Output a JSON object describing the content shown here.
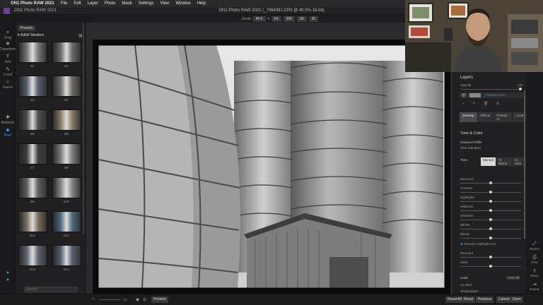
{
  "menubar": {
    "app_name": "ON1 Photo RAW 2021",
    "menus": [
      "File",
      "Edit",
      "Layer",
      "Photo",
      "Mask",
      "Settings",
      "View",
      "Window",
      "Help"
    ]
  },
  "window": {
    "title": "ON1 Photo RAW 2021 (_7064261.CR3 @ 40.5% 16-bit)",
    "app_label": "ON1 Photo RAW 2021"
  },
  "toolbar": {
    "zoom_label": "Zoom",
    "zoom_value": "40.5",
    "fit_label": "Fit",
    "zoom_presets": [
      "100",
      "50",
      "25"
    ]
  },
  "tools": [
    {
      "label": "Crop",
      "icon": "crop-icon",
      "glyph": "⌗"
    },
    {
      "label": "Transform",
      "icon": "transform-icon",
      "glyph": "✥"
    },
    {
      "label": "Text",
      "icon": "text-icon",
      "glyph": "T"
    },
    {
      "label": "Local",
      "icon": "brush-icon",
      "glyph": "✎"
    },
    {
      "label": "Faces",
      "icon": "face-icon",
      "glyph": "☺"
    },
    {
      "label": "Retouch",
      "icon": "retouch-icon",
      "glyph": "✚"
    },
    {
      "label": "Pixel",
      "icon": "pixel-icon",
      "glyph": "◆"
    }
  ],
  "presets": {
    "tab_label": "Presets",
    "category": "B&W Modern",
    "search_placeholder": "Search",
    "items": [
      "B1",
      "B2",
      "B3",
      "B4",
      "B5",
      "B6",
      "B7",
      "B8",
      "B9",
      "B10",
      "B11",
      "B12",
      "B13",
      "B14"
    ],
    "tints": [
      "#777",
      "#6a6a6a",
      "#55606e",
      "#6e6a63",
      "#4d4a4d",
      "#8a7c66",
      "#3d3d3d",
      "#7d7d7d",
      "#5f5f5f",
      "#858585",
      "#7a6c5c",
      "#4e6a80",
      "#5d6470",
      "#54606e"
    ]
  },
  "right_panel": {
    "layers_title": "Layers",
    "opacity_label": "Opacity",
    "opacity_value": 100,
    "layer_name": "_7064261.CR3",
    "module_tabs": [
      "Develop",
      "Effects",
      "Portrait AI",
      "Local"
    ],
    "selected_tab": "Develop",
    "section_title": "Tone & Color",
    "camera_profile_label": "Camera Profile",
    "camera_profile_value": "ON1 Standard",
    "tone_label": "Tone:",
    "tone_modes": [
      "Manual",
      "AI Match",
      "AI Auto"
    ],
    "selected_tone_mode": "Manual",
    "sliders": [
      {
        "label": "Exposure",
        "value": 0.5
      },
      {
        "label": "Contrast",
        "value": 0.5
      },
      {
        "label": "Highlights",
        "value": 0.5
      },
      {
        "label": "Midtones",
        "value": 0.5
      },
      {
        "label": "Shadows",
        "value": 0.5
      },
      {
        "label": "Whites",
        "value": 0.5
      },
      {
        "label": "Blacks",
        "value": 0.5
      }
    ],
    "recover_label": "Recover Highlight Hue",
    "structure_label": "Structure",
    "haze_label": "Haze",
    "color_label": "Color:",
    "auto_off_label": "Auto Off",
    "color_mode": "As Shot",
    "temperature_label": "Temperature"
  },
  "right_strip": [
    {
      "label": "Resize",
      "icon": "resize-icon",
      "glyph": "⤢"
    },
    {
      "label": "Print",
      "icon": "print-icon",
      "glyph": "⎙"
    },
    {
      "label": "Share",
      "icon": "share-icon",
      "glyph": "⇪"
    },
    {
      "label": "Export",
      "icon": "export-icon",
      "glyph": "⇥"
    }
  ],
  "bottom": {
    "preview_label": "Preview",
    "reset_all": "Reset All",
    "reset": "Reset",
    "previous": "Previous",
    "cancel": "Cancel",
    "done": "Done"
  },
  "colors": {
    "accent": "#3a8ee6",
    "panel": "#212123",
    "background": "#1b1b1d"
  }
}
